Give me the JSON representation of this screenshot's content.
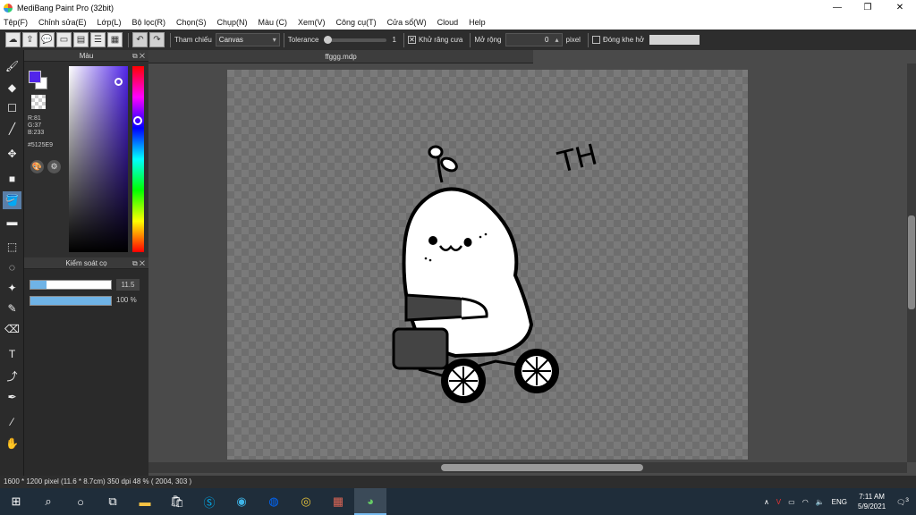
{
  "window": {
    "title": "MediBang Paint Pro (32bit)",
    "minimize": "—",
    "maximize": "❐",
    "close": "✕"
  },
  "menu": [
    "Tệp(F)",
    "Chỉnh sửa(E)",
    "Lớp(L)",
    "Bộ lọc(R)",
    "Chọn(S)",
    "Chụp(N)",
    "Màu (C)",
    "Xem(V)",
    "Công cụ(T)",
    "Cửa sổ(W)",
    "Cloud",
    "Help"
  ],
  "toolbar": {
    "reference_label": "Tham chiếu",
    "reference_value": "Canvas",
    "tolerance_label": "Tolerance",
    "tolerance_value": "1",
    "tolerance_level": 0,
    "antialias_label": "Khử răng cưa",
    "antialias_checked": true,
    "expand_label": "Mở rộng",
    "expand_value": "0",
    "pixel_label": "pixel",
    "gap_label": "Đóng khe hở",
    "gap_checked": false
  },
  "color_panel": {
    "title": "Màu",
    "r": "R:81",
    "g": "G:37",
    "b": "B:233",
    "hex": "#5125E9",
    "fg_color": "#5125E9",
    "bg_color": "#ffffff"
  },
  "brush_panel": {
    "title": "Kiểm soát cọ",
    "size_value": "11.5",
    "size_level": 0.2,
    "opacity_value": "100 %",
    "opacity_level": 1.0
  },
  "document": {
    "tab_name": "ffggg.mdp",
    "drawing_text": "TH"
  },
  "status": {
    "text": "1600 * 1200 pixel   (11.6 * 8.7cm)   350 dpi   48 %   ( 2004, 303 )"
  },
  "taskbar": {
    "time": "7:11 AM",
    "date": "5/9/2021",
    "lang": "ENG",
    "notification_count": "3"
  },
  "colors": {
    "accent": "#5a7fa8",
    "brush_bar": "#6fb3e6"
  }
}
